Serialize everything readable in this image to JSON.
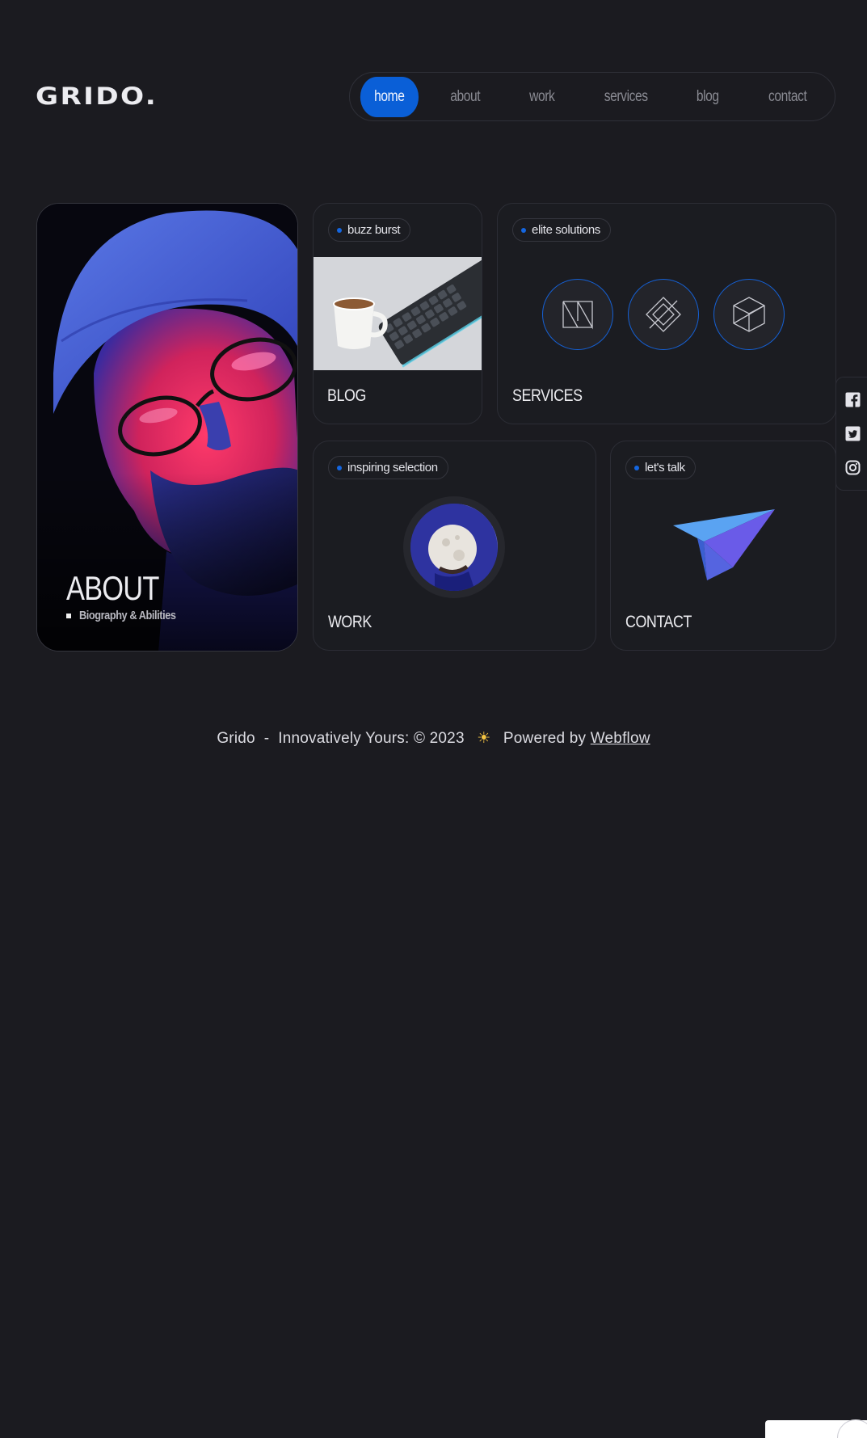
{
  "header": {
    "logo": "GRIDO.",
    "nav": [
      {
        "label": "home",
        "active": true
      },
      {
        "label": "about",
        "active": false
      },
      {
        "label": "work",
        "active": false
      },
      {
        "label": "services",
        "active": false
      },
      {
        "label": "blog",
        "active": false
      },
      {
        "label": "contact",
        "active": false
      }
    ]
  },
  "cards": {
    "about": {
      "title": "ABOUT",
      "subtitle": "Biography & Abilities"
    },
    "blog": {
      "tag": "buzz burst",
      "title": "BLOG"
    },
    "services": {
      "tag": "elite solutions",
      "title": "SERVICES",
      "icons": [
        "n-logo-icon",
        "diamond-logo-icon",
        "cube-logo-icon"
      ]
    },
    "work": {
      "tag": "inspiring selection",
      "title": "WORK"
    },
    "contact": {
      "tag": "let's talk",
      "title": "CONTACT"
    }
  },
  "socials": [
    "facebook-icon",
    "twitter-icon",
    "instagram-icon"
  ],
  "footer": {
    "brand": "Grido",
    "separator": "-",
    "text": "Innovatively Yours: © 2023",
    "powered": "Powered by",
    "link": "Webflow"
  },
  "colors": {
    "background": "#1b1b20",
    "accent": "#0a5fd7",
    "border": "#2c2d35"
  }
}
